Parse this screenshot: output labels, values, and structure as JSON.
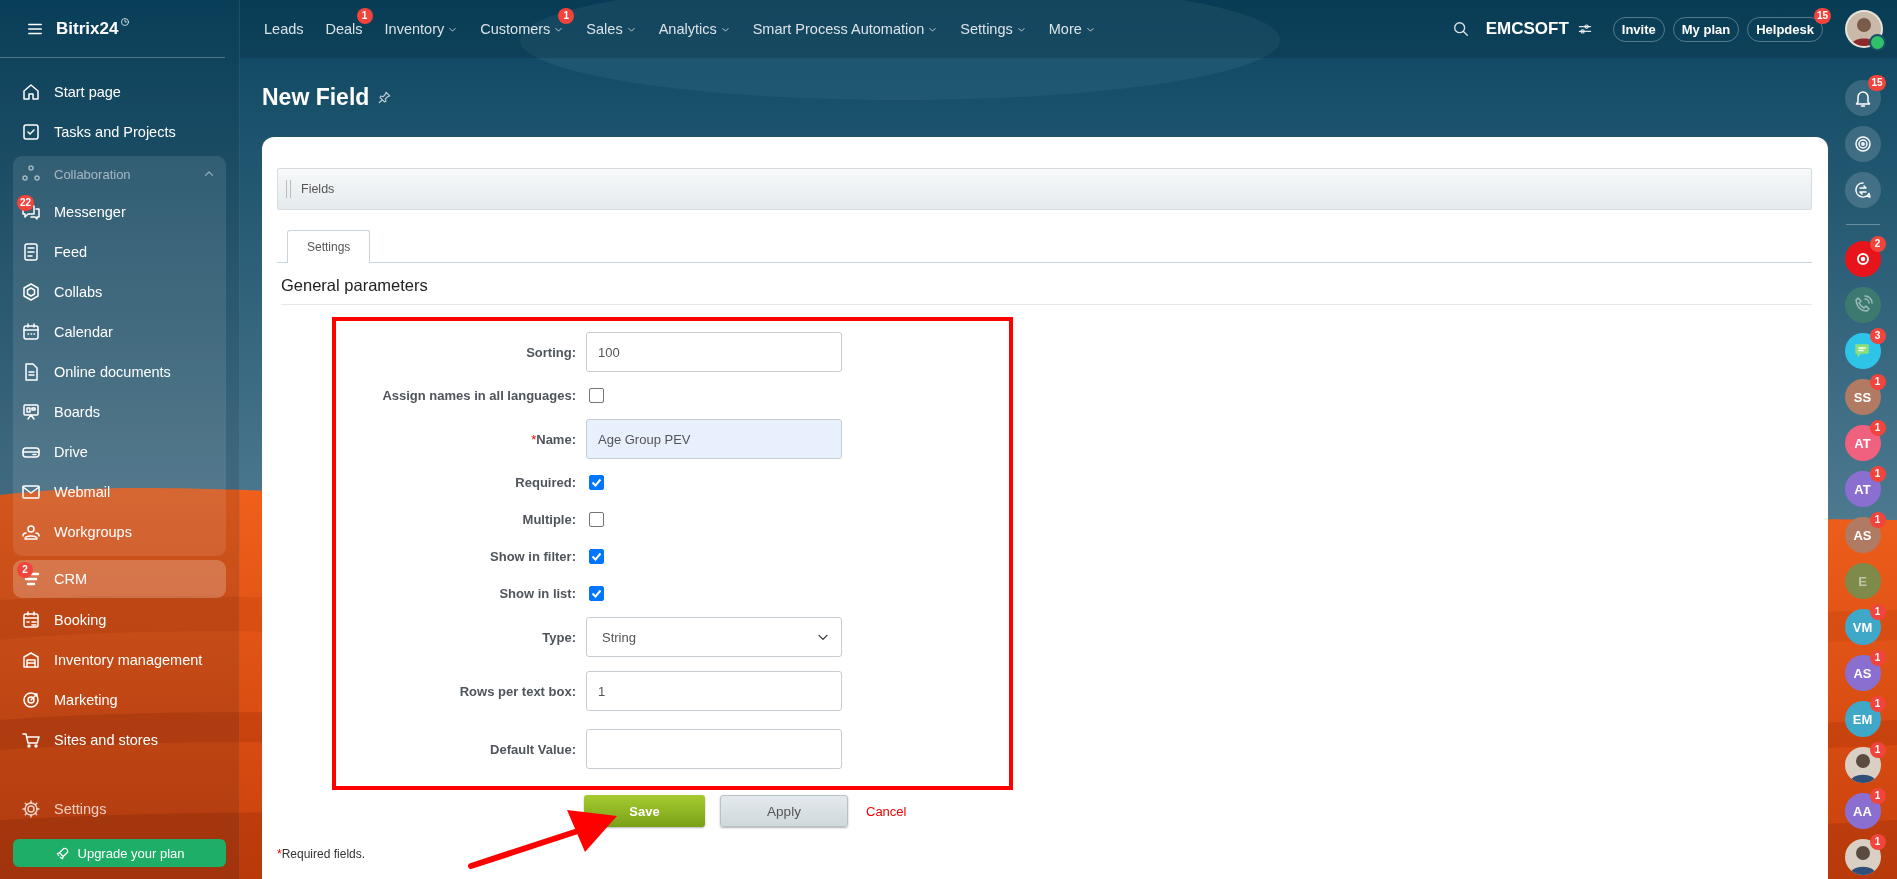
{
  "sidebar": {
    "logo": "Bitrix24",
    "items": [
      {
        "kind": "link",
        "label": "Start page",
        "selected": false
      },
      {
        "kind": "link",
        "label": "Tasks and Projects",
        "selected": false
      },
      {
        "kind": "group",
        "label": "Collaboration",
        "selected": false,
        "expanded": true,
        "children": [
          {
            "kind": "link",
            "label": "Messenger",
            "selected": false,
            "badge": "22"
          },
          {
            "kind": "link",
            "label": "Feed",
            "selected": false
          },
          {
            "kind": "link",
            "label": "Collabs",
            "selected": false
          },
          {
            "kind": "link",
            "label": "Calendar",
            "selected": false
          },
          {
            "kind": "link",
            "label": "Online documents",
            "selected": false
          },
          {
            "kind": "link",
            "label": "Boards",
            "selected": false
          },
          {
            "kind": "link",
            "label": "Drive",
            "selected": false
          },
          {
            "kind": "link",
            "label": "Webmail",
            "selected": false
          },
          {
            "kind": "link",
            "label": "Workgroups",
            "selected": false
          }
        ]
      },
      {
        "kind": "link",
        "label": "CRM",
        "selected": true,
        "badge": "2"
      },
      {
        "kind": "link",
        "label": "Booking",
        "selected": false
      },
      {
        "kind": "link",
        "label": "Inventory management",
        "selected": false
      },
      {
        "kind": "link",
        "label": "Marketing",
        "selected": false
      },
      {
        "kind": "link",
        "label": "Sites and stores",
        "selected": false
      }
    ],
    "settings": "Settings",
    "upgrade": "Upgrade your plan"
  },
  "top_nav": [
    {
      "label": "Leads",
      "dropdown": false
    },
    {
      "label": "Deals",
      "dropdown": false,
      "badge": "1"
    },
    {
      "label": "Inventory",
      "dropdown": true
    },
    {
      "label": "Customers",
      "dropdown": true,
      "badge": "1"
    },
    {
      "label": "Sales",
      "dropdown": true
    },
    {
      "label": "Analytics",
      "dropdown": true
    },
    {
      "label": "Smart Process Automation",
      "dropdown": true
    },
    {
      "label": "Settings",
      "dropdown": true
    },
    {
      "label": "More",
      "dropdown": true
    }
  ],
  "header_right": {
    "company": "EMCSOFT",
    "buttons": [
      {
        "label": "Invite"
      },
      {
        "label": "My plan"
      },
      {
        "label": "Helpdesk",
        "badge": "15"
      }
    ],
    "user": {
      "online": true
    }
  },
  "page": {
    "title": "New Field",
    "breadcrumb": "Fields",
    "tabs": [
      {
        "label": "Settings",
        "selected": true
      }
    ],
    "section": "General parameters"
  },
  "form": {
    "rows": [
      {
        "kind": "text",
        "label": "Sorting:",
        "value": "100",
        "highlighted": false
      },
      {
        "kind": "checkbox",
        "label": "Assign names in all languages:",
        "checked": false
      },
      {
        "kind": "text",
        "label": "Name:",
        "required_mark": "*",
        "value": "Age Group PEV",
        "highlighted": true
      },
      {
        "kind": "checkbox",
        "label": "Required:",
        "checked": true
      },
      {
        "kind": "checkbox",
        "label": "Multiple:",
        "checked": false
      },
      {
        "kind": "checkbox",
        "label": "Show in filter:",
        "checked": true
      },
      {
        "kind": "checkbox",
        "label": "Show in list:",
        "checked": true
      },
      {
        "kind": "select",
        "label": "Type:",
        "value": "String"
      },
      {
        "kind": "text",
        "label": "Rows per text box:",
        "value": "1",
        "highlighted": false
      },
      {
        "kind": "text",
        "label": "Default Value:",
        "highlighted": false
      }
    ],
    "buttons": [
      {
        "kind": "primary",
        "label": "Save"
      },
      {
        "kind": "secondary",
        "label": "Apply"
      },
      {
        "kind": "link",
        "label": "Cancel"
      }
    ],
    "footnote": {
      "mark": "*",
      "text": "Required fields."
    }
  },
  "annotations": {
    "highlight_box": true,
    "arrow": true
  },
  "right_panel": [
    {
      "kind": "icon",
      "badge": "15",
      "dimmed": false
    },
    {
      "kind": "icon",
      "dimmed": false
    },
    {
      "kind": "icon",
      "dimmed": false
    },
    {
      "kind": "icon",
      "badge": "2",
      "dimmed": false
    },
    {
      "kind": "icon",
      "dimmed": true
    },
    {
      "kind": "icon",
      "badge": "3",
      "dimmed": false
    },
    {
      "kind": "avatar",
      "initials": "SS",
      "color": "#b07a63",
      "badge": "1",
      "dimmed": false
    },
    {
      "kind": "avatar",
      "initials": "AT",
      "color": "#f0607f",
      "badge": "1",
      "dimmed": false
    },
    {
      "kind": "avatar",
      "initials": "AT",
      "color": "#8a6fd0",
      "badge": "1",
      "dimmed": false
    },
    {
      "kind": "avatar",
      "initials": "AS",
      "color": "#b07a63",
      "badge": "1",
      "dimmed": false
    },
    {
      "kind": "avatar",
      "initials": "E",
      "color": "#7d8a4a",
      "dimmed": true
    },
    {
      "kind": "avatar",
      "initials": "VM",
      "color": "#3fa7c8",
      "badge": "1",
      "dimmed": false
    },
    {
      "kind": "avatar",
      "initials": "AS",
      "color": "#8a6fd0",
      "badge": "1",
      "dimmed": false
    },
    {
      "kind": "avatar",
      "initials": "EM",
      "color": "#3fa7c8",
      "badge": "1",
      "dimmed": false
    },
    {
      "badge": "1",
      "dimmed": false
    },
    {
      "kind": "avatar",
      "initials": "AA",
      "color": "#8a6fd0",
      "badge": "1",
      "dimmed": false
    },
    {
      "badge": "1",
      "dimmed": false
    }
  ]
}
